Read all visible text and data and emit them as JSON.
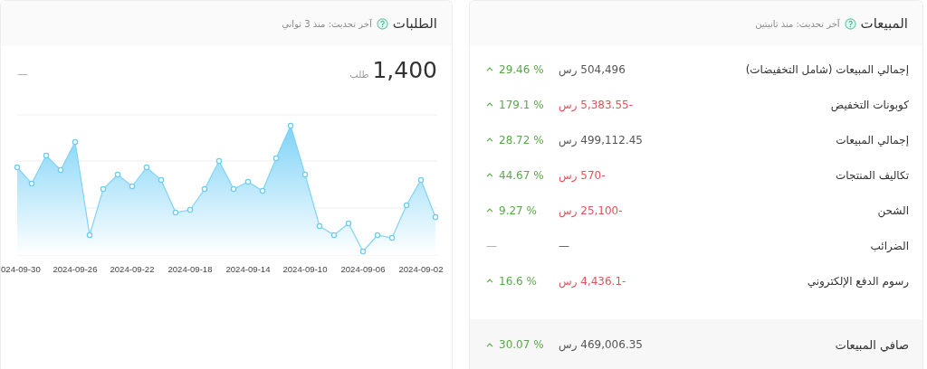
{
  "orders_card": {
    "title": "الطلبات",
    "updated": "آخر تحديث: منذ 3 ثواني",
    "total": "1,400",
    "unit": "طلب",
    "change": "—",
    "chart": {
      "x_labels": [
        "2024-09-02",
        "2024-09-06",
        "2024-09-10",
        "2024-09-14",
        "2024-09-18",
        "2024-09-22",
        "2024-09-26",
        "024-09-30"
      ]
    }
  },
  "sales_card": {
    "title": "المبيعات",
    "updated": "آخر تحديث: منذ ثانيتين",
    "rows": [
      {
        "kind": "row",
        "label": "إجمالي المبيعات (شامل التخفيضات)",
        "value": "504,496 رس",
        "negative": false,
        "change": "29.46 %",
        "rising": true
      },
      {
        "kind": "row",
        "label": "كوبونات التخفيض",
        "value": "-5,383.55 رس",
        "negative": true,
        "change": "179.1 %",
        "rising": true
      },
      {
        "kind": "row",
        "label": "إجمالي المبيعات",
        "value": "499,112.45 رس",
        "negative": false,
        "change": "28.72 %",
        "rising": true
      },
      {
        "kind": "row",
        "label": "تكاليف المنتجات",
        "value": "-570 رس",
        "negative": true,
        "change": "44.67 %",
        "rising": true
      },
      {
        "kind": "row",
        "label": "الشحن",
        "value": "-25,100 رس",
        "negative": true,
        "change": "9.27 %",
        "rising": true
      },
      {
        "kind": "row",
        "label": "الضرائب",
        "value": "—",
        "negative": false,
        "change": "—",
        "rising": false
      },
      {
        "kind": "row",
        "label": "رسوم الدفع الإلكتروني",
        "value": "-4,436.1 رس",
        "negative": true,
        "change": "16.6 %",
        "rising": true
      },
      {
        "kind": "total",
        "label": "صافي المبيعات",
        "value": "469,006.35 رس",
        "negative": false,
        "change": "30.07 %",
        "rising": true
      }
    ]
  }
}
